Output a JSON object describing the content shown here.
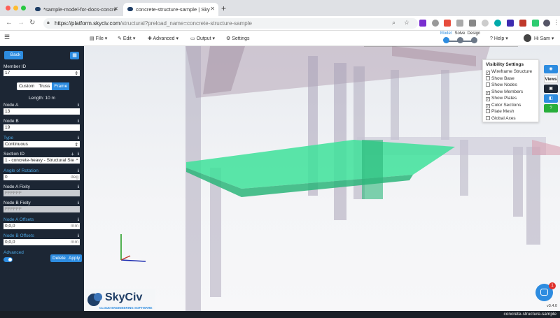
{
  "browser": {
    "tabs": [
      {
        "title": "*sample-model-for-docs-concre",
        "active": false
      },
      {
        "title": "concrete-structure-sample | Sky",
        "active": true
      }
    ],
    "url_host": "https://platform.skyciv.com",
    "url_path": "/structural?preload_name=concrete-structure-sample"
  },
  "app": {
    "menus": [
      "File",
      "Edit",
      "Advanced",
      "Output",
      "Settings"
    ],
    "modes": [
      "Model",
      "Solve",
      "Design"
    ],
    "help": "Help",
    "user": "Hi Sam"
  },
  "sidebar": {
    "back": "Back",
    "member_id_label": "Member ID",
    "member_id_value": "17",
    "tabs": [
      "Custom",
      "Truss",
      "Frame"
    ],
    "length": "Length: 10 m",
    "node_a_label": "Node A",
    "node_a_value": "13",
    "node_b_label": "Node B",
    "node_b_value": "19",
    "type_label": "Type",
    "type_value": "Continuous",
    "section_id_label": "Section ID",
    "section_id_value": "1 - concrete-heavy - Structural Ste",
    "rotation_label": "Angle of Rotation",
    "rotation_value": "0",
    "rotation_unit": "deg",
    "fixity_a_label": "Node A Fixity",
    "fixity_a_value": "FFFFFF",
    "fixity_b_label": "Node B Fixity",
    "fixity_b_value": "FFFFFF",
    "offsets_a_label": "Node A Offsets",
    "offsets_a_value": "0,0,0",
    "offsets_a_unit": "mm",
    "offsets_b_label": "Node B Offsets",
    "offsets_b_value": "0,0,0",
    "offsets_b_unit": "mm",
    "advanced_label": "Advanced",
    "delete": "Delete",
    "apply": "Apply"
  },
  "visibility": {
    "title": "Visibility Settings",
    "items": [
      {
        "label": "Wireframe Structure",
        "checked": true
      },
      {
        "label": "Show Base",
        "checked": false
      },
      {
        "label": "Show Nodes",
        "checked": false
      },
      {
        "label": "Show Members",
        "checked": true
      },
      {
        "label": "Show Plates",
        "checked": true
      },
      {
        "label": "Color Sections",
        "checked": true
      },
      {
        "label": "Plate Mesh",
        "checked": false
      },
      {
        "label": "Global Axes",
        "checked": false
      }
    ]
  },
  "tools": {
    "views": "Views"
  },
  "logo": {
    "name": "SkyCiv",
    "tagline": "CLOUD ENGINEERING SOFTWARE"
  },
  "chat_badge": "1",
  "version": "v3.4.0",
  "status_text": "concrete-structure-sample",
  "colors": {
    "accent": "#2d8ce0",
    "sidebar": "#1c2634",
    "plate": "#3ee29a"
  }
}
